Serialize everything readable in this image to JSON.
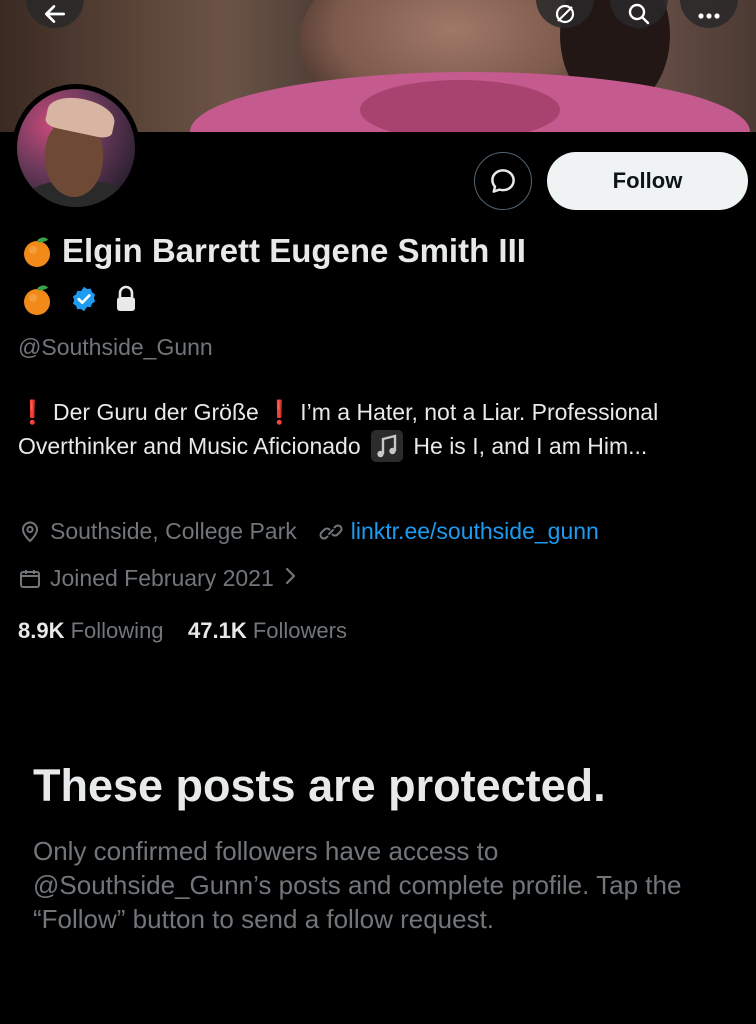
{
  "profile": {
    "display_name": "Elgin Barrett Eugene Smith III",
    "handle": "@Southside_Gunn",
    "bio": {
      "part1": "Der Guru der Größe",
      "part2": "I’m a Hater, not a Liar. Professional Overthinker and Music Aficionado",
      "part3": "He is I, and I am Him..."
    },
    "location": "Southside, College Park",
    "website": "linktr.ee/southside_gunn",
    "joined": "Joined February 2021",
    "following_count": "8.9K",
    "following_label": "Following",
    "followers_count": "47.1K",
    "followers_label": "Followers",
    "verified_color": "#1d9bf0"
  },
  "actions": {
    "follow_label": "Follow"
  },
  "protected": {
    "title": "These posts are protected.",
    "body": "Only confirmed followers have access to @Southside_Gunn’s posts and complete profile. Tap the “Follow” button to send a follow request."
  },
  "icons": [
    "back-arrow-icon",
    "grok-icon",
    "search-icon",
    "more-icon",
    "message-icon",
    "orange-emoji-icon",
    "verified-badge-icon",
    "lock-icon",
    "exclamation-icon",
    "music-note-icon",
    "location-icon",
    "link-icon",
    "calendar-icon",
    "chevron-right-icon"
  ],
  "colors": {
    "background": "#000000",
    "accent": "#1d9bf0",
    "muted": "#71767b",
    "text": "#e7e9ea",
    "exclamation": "#e0243b"
  }
}
